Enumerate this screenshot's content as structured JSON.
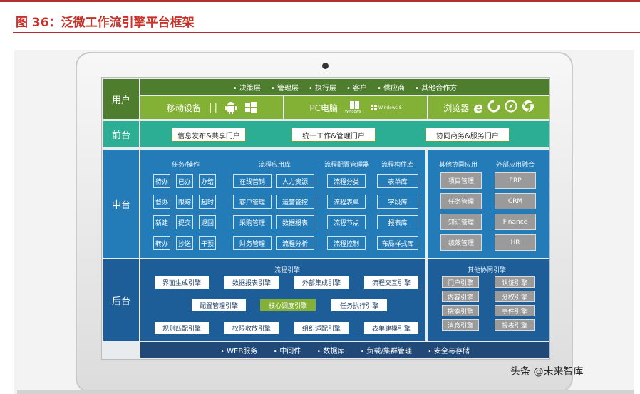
{
  "title": "图 36：泛微工作流引擎平台框架",
  "watermark": "头条 @未来智库",
  "rows": {
    "user": "用户",
    "front": "前台",
    "middle": "中台",
    "back": "后台"
  },
  "user_roles": [
    "决策层",
    "管理层",
    "执行层",
    "客户",
    "供应商",
    "其他合作方"
  ],
  "devices": {
    "mobile": "移动设备",
    "pc": "PC电脑",
    "win7": "Windows 7",
    "win8": "Windows 8",
    "browser": "浏览器"
  },
  "front_portals": [
    "信息发布&共享门户",
    "统一工作&管理门户",
    "协同商务&服务门户"
  ],
  "middle": {
    "task_header": "任务/操作",
    "tasks": [
      [
        "待办",
        "已办",
        "办结"
      ],
      [
        "督办",
        "跟踪",
        "超时"
      ],
      [
        "新建",
        "提交",
        "退回"
      ],
      [
        "转办",
        "抄送",
        "干预"
      ]
    ],
    "app_header": "流程应用库",
    "apps": [
      [
        "在线营销",
        "人力资源"
      ],
      [
        "客户管理",
        "运营管控"
      ],
      [
        "采购管理",
        "数据报表"
      ],
      [
        "财务管理",
        "流程分析"
      ]
    ],
    "config_header": "流程配置管理器",
    "configs": [
      "流程分类",
      "流程表单",
      "流程节点",
      "流程控制"
    ],
    "component_header": "流程构件库",
    "components": [
      "表单库",
      "字段库",
      "报表库",
      "布局样式库"
    ],
    "other_app_header": "其他协同应用",
    "other_apps": [
      "项目管理",
      "任务管理",
      "知识管理",
      "绩效管理"
    ],
    "external_header": "外部应用融合",
    "externals": [
      "ERP",
      "CRM",
      "Finance",
      "HR"
    ]
  },
  "back": {
    "engine_header": "流程引擎",
    "engines": [
      [
        "界面生成引擎",
        "数据报表引擎",
        "外部集成引擎",
        "流程交互引擎"
      ],
      [
        "配置管理引擎",
        "核心调度引擎",
        "任务执行引擎"
      ],
      [
        "规则匹配引擎",
        "权限收放引擎",
        "组织适配引擎",
        "表单建模引擎"
      ]
    ],
    "other_header": "其他协同引擎",
    "others": [
      [
        "门户引擎",
        "认证引擎"
      ],
      [
        "内容引擎",
        "分权引擎"
      ],
      [
        "搜索引擎",
        "事件引擎"
      ],
      [
        "消息引擎",
        "报表引擎"
      ]
    ]
  },
  "infra": [
    "WEB服务",
    "中间件",
    "数据库",
    "负载/集群管理",
    "安全与存储"
  ],
  "colors": {
    "title_red": "#c8312a",
    "user_green": "#4e7d2d",
    "device_lime": "#82b135",
    "front_teal": "#2bae93",
    "middle_blue": "#237bb8",
    "back_blue": "#1d5e98",
    "infra_navy": "#204978",
    "core_engine_green": "#82b135"
  }
}
